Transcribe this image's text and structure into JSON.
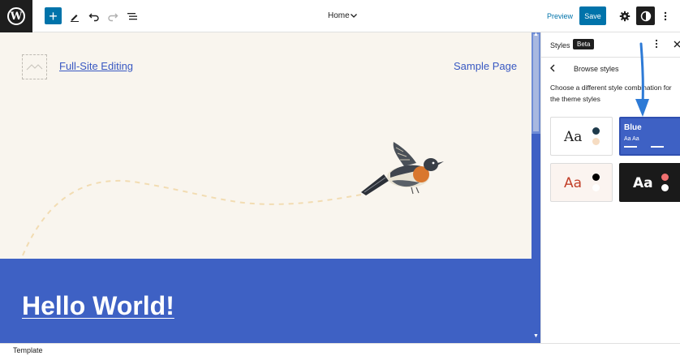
{
  "toolbar": {
    "document_title": "Home",
    "preview_label": "Preview",
    "save_label": "Save"
  },
  "canvas": {
    "site_title": "Full-Site Editing",
    "nav_link": "Sample Page",
    "hero_heading": "Hello World!"
  },
  "sidebar": {
    "title": "Styles",
    "badge": "Beta",
    "panel_title": "Browse styles",
    "description": "Choose a different style combination for the theme styles",
    "styles": [
      {
        "sample": "Aa",
        "colors": [
          "#1e3a4b",
          "#f6dcc2"
        ],
        "background": "#ffffff",
        "text_color": "#1e1e1e"
      },
      {
        "name": "Blue",
        "sample": "Aa Aa",
        "background": "#3e61c4",
        "selected": true
      },
      {
        "sample": "Aa",
        "colors": [
          "#000000",
          "#ffffff"
        ],
        "background": "#fbf4f0",
        "text_color": "#c2402a"
      },
      {
        "sample": "Aa",
        "colors": [
          "#f07070",
          "#ffffff"
        ],
        "background": "#1a1a1a",
        "text_color": "#ffffff"
      }
    ]
  },
  "statusbar": {
    "label": "Template"
  },
  "colors": {
    "accent": "#0073aa",
    "hero_blue": "#3e61c4",
    "canvas_bg": "#f9f5ee",
    "link_blue": "#3858c2"
  }
}
